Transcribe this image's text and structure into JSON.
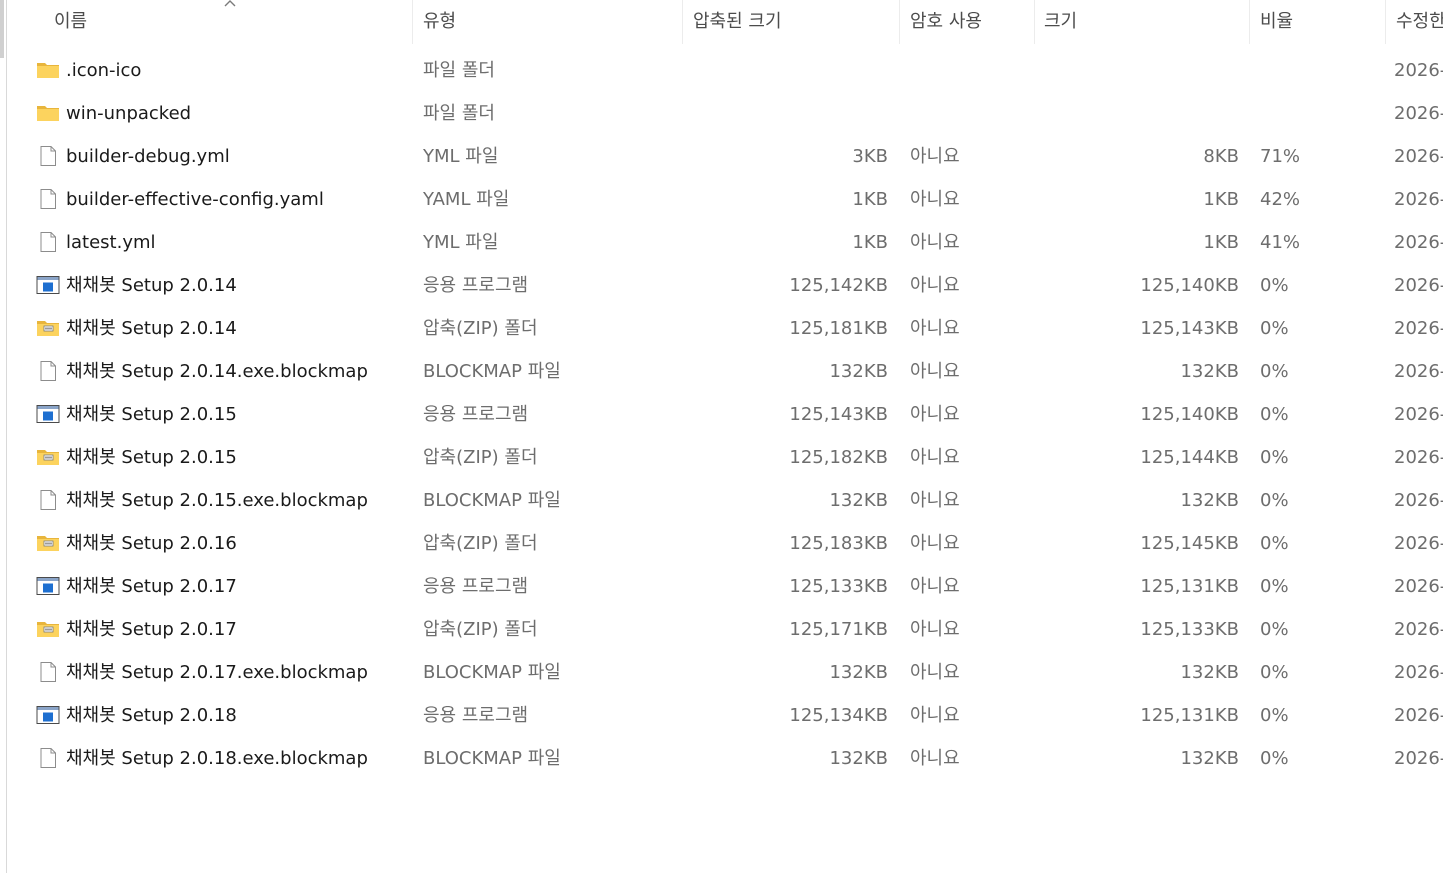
{
  "columns": {
    "name": "이름",
    "type": "유형",
    "compressed_size": "압축된 크기",
    "password": "암호 사용",
    "size": "크기",
    "ratio": "비율",
    "modified": "수정한"
  },
  "files": [
    {
      "icon": "folder-icon",
      "name": ".icon-ico",
      "type": "파일 폴더",
      "compressed_size": "",
      "password": "",
      "size": "",
      "ratio": "",
      "modified": "2026-"
    },
    {
      "icon": "folder-icon",
      "name": "win-unpacked",
      "type": "파일 폴더",
      "compressed_size": "",
      "password": "",
      "size": "",
      "ratio": "",
      "modified": "2026-"
    },
    {
      "icon": "file-icon",
      "name": "builder-debug.yml",
      "type": "YML 파일",
      "compressed_size": "3KB",
      "password": "아니요",
      "size": "8KB",
      "ratio": "71%",
      "modified": "2026-"
    },
    {
      "icon": "file-icon",
      "name": "builder-effective-config.yaml",
      "type": "YAML 파일",
      "compressed_size": "1KB",
      "password": "아니요",
      "size": "1KB",
      "ratio": "42%",
      "modified": "2026-"
    },
    {
      "icon": "file-icon",
      "name": "latest.yml",
      "type": "YML 파일",
      "compressed_size": "1KB",
      "password": "아니요",
      "size": "1KB",
      "ratio": "41%",
      "modified": "2026-"
    },
    {
      "icon": "application-icon",
      "name": "채채봇 Setup 2.0.14",
      "type": "응용 프로그램",
      "compressed_size": "125,142KB",
      "password": "아니요",
      "size": "125,140KB",
      "ratio": "0%",
      "modified": "2026-"
    },
    {
      "icon": "zip-folder-icon",
      "name": "채채봇 Setup 2.0.14",
      "type": "압축(ZIP) 폴더",
      "compressed_size": "125,181KB",
      "password": "아니요",
      "size": "125,143KB",
      "ratio": "0%",
      "modified": "2026-"
    },
    {
      "icon": "file-icon",
      "name": "채채봇 Setup 2.0.14.exe.blockmap",
      "type": "BLOCKMAP 파일",
      "compressed_size": "132KB",
      "password": "아니요",
      "size": "132KB",
      "ratio": "0%",
      "modified": "2026-"
    },
    {
      "icon": "application-icon",
      "name": "채채봇 Setup 2.0.15",
      "type": "응용 프로그램",
      "compressed_size": "125,143KB",
      "password": "아니요",
      "size": "125,140KB",
      "ratio": "0%",
      "modified": "2026-"
    },
    {
      "icon": "zip-folder-icon",
      "name": "채채봇 Setup 2.0.15",
      "type": "압축(ZIP) 폴더",
      "compressed_size": "125,182KB",
      "password": "아니요",
      "size": "125,144KB",
      "ratio": "0%",
      "modified": "2026-"
    },
    {
      "icon": "file-icon",
      "name": "채채봇 Setup 2.0.15.exe.blockmap",
      "type": "BLOCKMAP 파일",
      "compressed_size": "132KB",
      "password": "아니요",
      "size": "132KB",
      "ratio": "0%",
      "modified": "2026-"
    },
    {
      "icon": "zip-folder-icon",
      "name": "채채봇 Setup 2.0.16",
      "type": "압축(ZIP) 폴더",
      "compressed_size": "125,183KB",
      "password": "아니요",
      "size": "125,145KB",
      "ratio": "0%",
      "modified": "2026-"
    },
    {
      "icon": "application-icon",
      "name": "채채봇 Setup 2.0.17",
      "type": "응용 프로그램",
      "compressed_size": "125,133KB",
      "password": "아니요",
      "size": "125,131KB",
      "ratio": "0%",
      "modified": "2026-"
    },
    {
      "icon": "zip-folder-icon",
      "name": "채채봇 Setup 2.0.17",
      "type": "압축(ZIP) 폴더",
      "compressed_size": "125,171KB",
      "password": "아니요",
      "size": "125,133KB",
      "ratio": "0%",
      "modified": "2026-"
    },
    {
      "icon": "file-icon",
      "name": "채채봇 Setup 2.0.17.exe.blockmap",
      "type": "BLOCKMAP 파일",
      "compressed_size": "132KB",
      "password": "아니요",
      "size": "132KB",
      "ratio": "0%",
      "modified": "2026-"
    },
    {
      "icon": "application-icon",
      "name": "채채봇 Setup 2.0.18",
      "type": "응용 프로그램",
      "compressed_size": "125,134KB",
      "password": "아니요",
      "size": "125,131KB",
      "ratio": "0%",
      "modified": "2026-"
    },
    {
      "icon": "file-icon",
      "name": "채채봇 Setup 2.0.18.exe.blockmap",
      "type": "BLOCKMAP 파일",
      "compressed_size": "132KB",
      "password": "아니요",
      "size": "132KB",
      "ratio": "0%",
      "modified": "2026-"
    }
  ]
}
